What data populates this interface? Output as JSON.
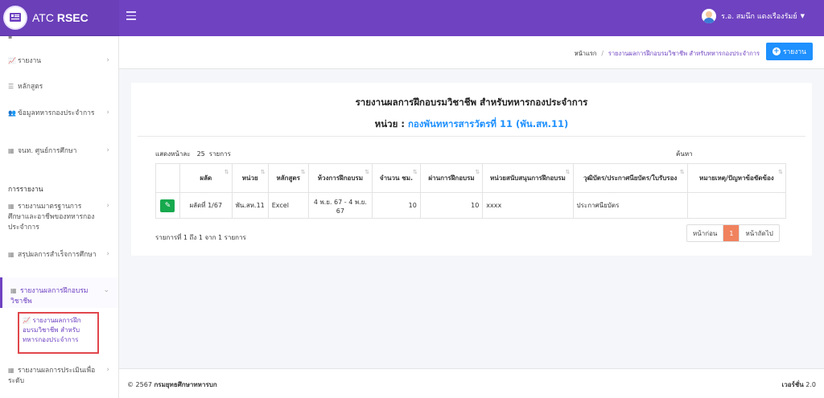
{
  "brand": {
    "name_prefix": "ATC",
    "name_bold": "RSEC"
  },
  "user": {
    "name": "ร.อ. สมนึก แดงเรืองรัมย์"
  },
  "sidebar": {
    "items": [
      {
        "label": "รายงาน"
      },
      {
        "label": "หลักสูตร"
      },
      {
        "label": "ข้อมูลทหารกองประจำการ"
      },
      {
        "label": "จนท. ศูนย์การศึกษา"
      },
      {
        "label": "รายงานมาตรฐานการศึกษาและอาชีพของทหารกองประจำการ"
      },
      {
        "label": "สรุปผลการสำเร็จการศึกษา"
      },
      {
        "label": "รายงานผลการฝึกอบรมวิชาชีพ"
      },
      {
        "label": "รายงานผลการประเมินเพื่อระดับ"
      }
    ],
    "section_header": "การรายงาน",
    "active_sub": "รายงานผลการฝึกอบรมวิชาชีพ สำหรับทหารกองประจำการ"
  },
  "breadcrumb": {
    "home": "หน้าแรก",
    "current": "รายงานผลการฝึกอบรมวิชาชีพ สำหรับทหารกองประจำการ"
  },
  "report_button": "รายงาน",
  "card": {
    "title": "รายงานผลการฝึกอบรมวิชาชีพ สำหรับทหารกองประจำการ",
    "unit_label": "หน่วย :",
    "unit_name": "กองพันทหารสารวัตรที่ 11 (พัน.สห.11)",
    "show_label": "แสดงหน้าละ",
    "show_count": "25",
    "show_suffix": "รายการ",
    "search_label": "ค้นหา"
  },
  "table": {
    "headers": [
      "ผลัด",
      "หน่วย",
      "หลักสูตร",
      "ห้วงการฝึกอบรม",
      "จำนวน ชม.",
      "ผ่านการฝึกอบรม",
      "หน่วยสนับสนุนการฝึกอบรม",
      "วุฒิบัตร/ประกาศนียบัตร/ใบรับรอง",
      "หมายเหตุ/ปัญหาข้อขัดข้อง"
    ],
    "rows": [
      {
        "round": "ผลัดที่ 1/67",
        "unit": "พัน.สห.11",
        "course": "Excel",
        "period": "4 พ.ย. 67 - 4 พ.ย. 67",
        "hours": "10",
        "passed": "10",
        "support": "xxxx",
        "certificate": "ประกาศนียบัตร",
        "note": ""
      }
    ]
  },
  "pagination": {
    "info": "รายการที่ 1 ถึง 1 จาก 1 รายการ",
    "prev": "หน้าก่อน",
    "page": "1",
    "next": "หน้าถัดไป"
  },
  "footer": {
    "year": "© 2567",
    "org": "กรมยุทธศึกษาทหารบก",
    "version_label": "เวอร์ชั่น",
    "version": "2.0"
  },
  "colors": {
    "primary": "#6f42c1",
    "accent": "#1e90ff",
    "success": "#17a94e",
    "highlight": "#e0474c"
  }
}
